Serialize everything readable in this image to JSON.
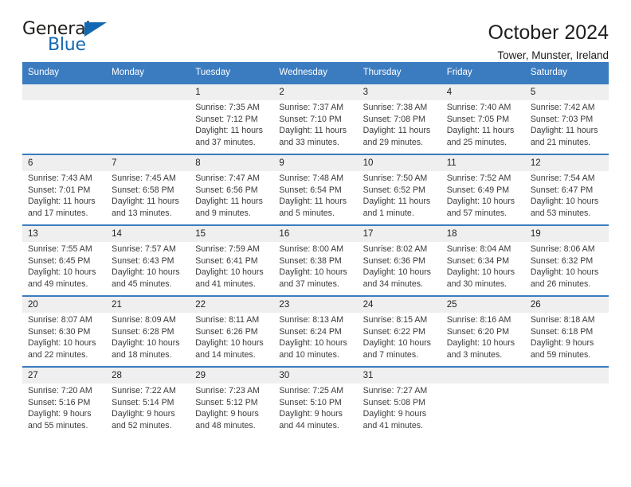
{
  "brand": {
    "name_top": "General",
    "name_bottom": "Blue",
    "triangle_color": "#1268b3"
  },
  "header": {
    "title": "October 2024",
    "subtitle": "Tower, Munster, Ireland"
  },
  "colors": {
    "header_blue": "#3b7cc0",
    "daynum_band": "#efefef",
    "text": "#222222"
  },
  "weekdays": [
    "Sunday",
    "Monday",
    "Tuesday",
    "Wednesday",
    "Thursday",
    "Friday",
    "Saturday"
  ],
  "weeks": [
    [
      {
        "day": "",
        "info": ""
      },
      {
        "day": "",
        "info": ""
      },
      {
        "day": "1",
        "info": "Sunrise: 7:35 AM\nSunset: 7:12 PM\nDaylight: 11 hours and 37 minutes."
      },
      {
        "day": "2",
        "info": "Sunrise: 7:37 AM\nSunset: 7:10 PM\nDaylight: 11 hours and 33 minutes."
      },
      {
        "day": "3",
        "info": "Sunrise: 7:38 AM\nSunset: 7:08 PM\nDaylight: 11 hours and 29 minutes."
      },
      {
        "day": "4",
        "info": "Sunrise: 7:40 AM\nSunset: 7:05 PM\nDaylight: 11 hours and 25 minutes."
      },
      {
        "day": "5",
        "info": "Sunrise: 7:42 AM\nSunset: 7:03 PM\nDaylight: 11 hours and 21 minutes."
      }
    ],
    [
      {
        "day": "6",
        "info": "Sunrise: 7:43 AM\nSunset: 7:01 PM\nDaylight: 11 hours and 17 minutes."
      },
      {
        "day": "7",
        "info": "Sunrise: 7:45 AM\nSunset: 6:58 PM\nDaylight: 11 hours and 13 minutes."
      },
      {
        "day": "8",
        "info": "Sunrise: 7:47 AM\nSunset: 6:56 PM\nDaylight: 11 hours and 9 minutes."
      },
      {
        "day": "9",
        "info": "Sunrise: 7:48 AM\nSunset: 6:54 PM\nDaylight: 11 hours and 5 minutes."
      },
      {
        "day": "10",
        "info": "Sunrise: 7:50 AM\nSunset: 6:52 PM\nDaylight: 11 hours and 1 minute."
      },
      {
        "day": "11",
        "info": "Sunrise: 7:52 AM\nSunset: 6:49 PM\nDaylight: 10 hours and 57 minutes."
      },
      {
        "day": "12",
        "info": "Sunrise: 7:54 AM\nSunset: 6:47 PM\nDaylight: 10 hours and 53 minutes."
      }
    ],
    [
      {
        "day": "13",
        "info": "Sunrise: 7:55 AM\nSunset: 6:45 PM\nDaylight: 10 hours and 49 minutes."
      },
      {
        "day": "14",
        "info": "Sunrise: 7:57 AM\nSunset: 6:43 PM\nDaylight: 10 hours and 45 minutes."
      },
      {
        "day": "15",
        "info": "Sunrise: 7:59 AM\nSunset: 6:41 PM\nDaylight: 10 hours and 41 minutes."
      },
      {
        "day": "16",
        "info": "Sunrise: 8:00 AM\nSunset: 6:38 PM\nDaylight: 10 hours and 37 minutes."
      },
      {
        "day": "17",
        "info": "Sunrise: 8:02 AM\nSunset: 6:36 PM\nDaylight: 10 hours and 34 minutes."
      },
      {
        "day": "18",
        "info": "Sunrise: 8:04 AM\nSunset: 6:34 PM\nDaylight: 10 hours and 30 minutes."
      },
      {
        "day": "19",
        "info": "Sunrise: 8:06 AM\nSunset: 6:32 PM\nDaylight: 10 hours and 26 minutes."
      }
    ],
    [
      {
        "day": "20",
        "info": "Sunrise: 8:07 AM\nSunset: 6:30 PM\nDaylight: 10 hours and 22 minutes."
      },
      {
        "day": "21",
        "info": "Sunrise: 8:09 AM\nSunset: 6:28 PM\nDaylight: 10 hours and 18 minutes."
      },
      {
        "day": "22",
        "info": "Sunrise: 8:11 AM\nSunset: 6:26 PM\nDaylight: 10 hours and 14 minutes."
      },
      {
        "day": "23",
        "info": "Sunrise: 8:13 AM\nSunset: 6:24 PM\nDaylight: 10 hours and 10 minutes."
      },
      {
        "day": "24",
        "info": "Sunrise: 8:15 AM\nSunset: 6:22 PM\nDaylight: 10 hours and 7 minutes."
      },
      {
        "day": "25",
        "info": "Sunrise: 8:16 AM\nSunset: 6:20 PM\nDaylight: 10 hours and 3 minutes."
      },
      {
        "day": "26",
        "info": "Sunrise: 8:18 AM\nSunset: 6:18 PM\nDaylight: 9 hours and 59 minutes."
      }
    ],
    [
      {
        "day": "27",
        "info": "Sunrise: 7:20 AM\nSunset: 5:16 PM\nDaylight: 9 hours and 55 minutes."
      },
      {
        "day": "28",
        "info": "Sunrise: 7:22 AM\nSunset: 5:14 PM\nDaylight: 9 hours and 52 minutes."
      },
      {
        "day": "29",
        "info": "Sunrise: 7:23 AM\nSunset: 5:12 PM\nDaylight: 9 hours and 48 minutes."
      },
      {
        "day": "30",
        "info": "Sunrise: 7:25 AM\nSunset: 5:10 PM\nDaylight: 9 hours and 44 minutes."
      },
      {
        "day": "31",
        "info": "Sunrise: 7:27 AM\nSunset: 5:08 PM\nDaylight: 9 hours and 41 minutes."
      },
      {
        "day": "",
        "info": ""
      },
      {
        "day": "",
        "info": ""
      }
    ]
  ]
}
